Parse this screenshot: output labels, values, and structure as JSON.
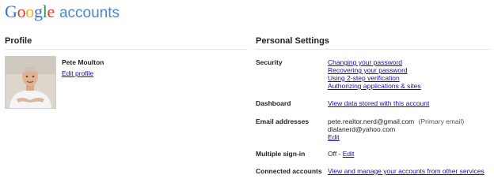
{
  "logo": {
    "brand_letters": [
      {
        "ch": "G",
        "color": "#3b6fd6"
      },
      {
        "ch": "o",
        "color": "#dd3b2c"
      },
      {
        "ch": "o",
        "color": "#f2b112"
      },
      {
        "ch": "g",
        "color": "#3b6fd6"
      },
      {
        "ch": "l",
        "color": "#2f9b48"
      },
      {
        "ch": "e",
        "color": "#dd3b2c"
      }
    ],
    "product": "accounts"
  },
  "profile": {
    "section_title": "Profile",
    "name": "Pete Moulton",
    "edit_link": "Edit profile"
  },
  "personal_settings": {
    "section_title": "Personal Settings",
    "security": {
      "label": "Security",
      "links": [
        "Changing your password",
        "Recovering your password",
        "Using 2-step verification",
        "Authorizing applications & sites"
      ]
    },
    "dashboard": {
      "label": "Dashboard",
      "link": "View data stored with this account"
    },
    "email": {
      "label": "Email addresses",
      "primary": "pete.realtor.nerd@gmail.com",
      "primary_note": "(Primary email)",
      "secondary": "dialanerd@yahoo.com",
      "edit_link": "Edit"
    },
    "multiple_signin": {
      "label": "Multiple sign-in",
      "status": "Off",
      "separator": " - ",
      "edit_link": "Edit"
    },
    "connected": {
      "label": "Connected accounts",
      "link": "View and manage your accounts from other services"
    }
  }
}
